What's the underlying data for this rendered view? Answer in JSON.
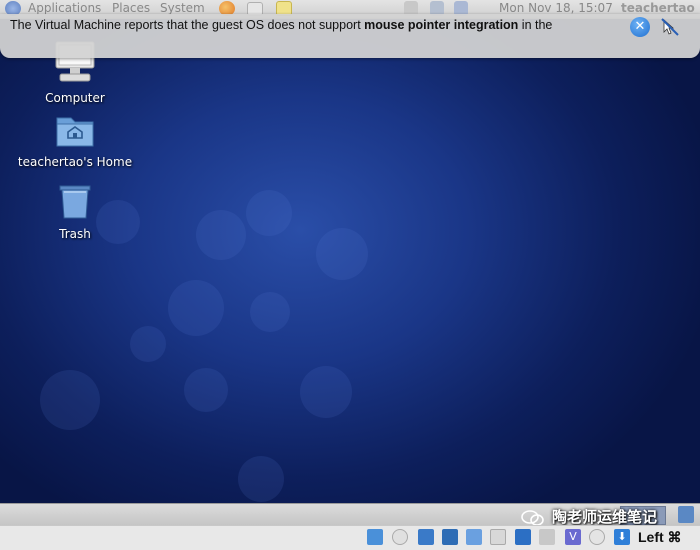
{
  "panel": {
    "menus": [
      "Applications",
      "Places",
      "System"
    ],
    "clock": "Mon Nov 18, 15:07",
    "username": "teachertao"
  },
  "notification": {
    "text_before": "The Virtual Machine reports that the guest OS does not support ",
    "text_bold": "mouse pointer integration",
    "text_after": " in the",
    "close_icon": "close-icon"
  },
  "desktop": {
    "icons": [
      {
        "label": "Computer",
        "icon": "computer-icon"
      },
      {
        "label": "teachertao's Home",
        "icon": "home-folder-icon"
      },
      {
        "label": "Trash",
        "icon": "trash-icon"
      }
    ]
  },
  "statusbar": {
    "host_key": "Left ⌘",
    "watermark": "陶老师运维笔记"
  },
  "colors": {
    "desktop_bg": "#1a3687",
    "accent": "#1f6fd0"
  }
}
